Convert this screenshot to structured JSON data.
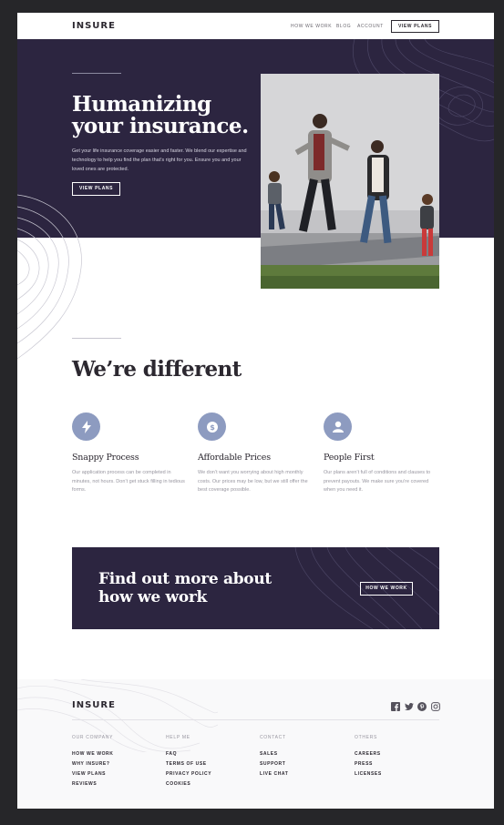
{
  "header": {
    "logo": "INSURE",
    "nav": [
      "HOW WE WORK",
      "BLOG",
      "ACCOUNT"
    ],
    "cta": "VIEW PLANS"
  },
  "hero": {
    "title": "Humanizing your insurance.",
    "text": "Get your life insurance coverage easier and faster. We blend our expertise and technology to help you find the plan that’s right for you. Ensure you and your loved ones are protected.",
    "button": "VIEW PLANS"
  },
  "different": {
    "title": "We’re different",
    "features": [
      {
        "icon": "lightning-icon",
        "title": "Snappy Process",
        "text": "Our application process can be completed in minutes, not hours. Don’t get stuck filling in tedious forms."
      },
      {
        "icon": "dollar-icon",
        "title": "Affordable Prices",
        "text": "We don’t want you worrying about high monthly costs. Our prices may be low, but we still offer the best coverage possible."
      },
      {
        "icon": "person-icon",
        "title": "People First",
        "text": "Our plans aren’t full of conditions and clauses to prevent payouts. We make sure you’re covered when you need it."
      }
    ]
  },
  "cta": {
    "title": "Find out more about how we work",
    "button": "HOW WE WORK"
  },
  "footer": {
    "logo": "INSURE",
    "social": [
      "facebook-icon",
      "twitter-icon",
      "pinterest-icon",
      "instagram-icon"
    ],
    "columns": [
      {
        "heading": "OUR COMPANY",
        "links": [
          "HOW WE WORK",
          "WHY INSURE?",
          "VIEW PLANS",
          "REVIEWS"
        ]
      },
      {
        "heading": "HELP ME",
        "links": [
          "FAQ",
          "TERMS OF USE",
          "PRIVACY POLICY",
          "COOKIES"
        ]
      },
      {
        "heading": "CONTACT",
        "links": [
          "SALES",
          "SUPPORT",
          "LIVE CHAT"
        ]
      },
      {
        "heading": "OTHERS",
        "links": [
          "CAREERS",
          "PRESS",
          "LICENSES"
        ]
      }
    ]
  },
  "colors": {
    "background": "#262629",
    "dark_violet": "#2c2540",
    "accent_blue": "#8d9bc0",
    "text": "#2c2830",
    "muted": "#9896a0",
    "footer_bg": "#f9f9fa"
  }
}
